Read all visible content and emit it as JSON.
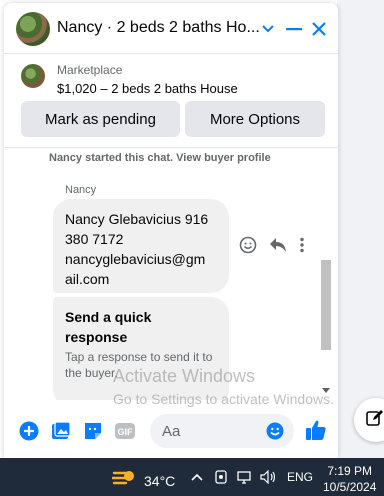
{
  "header": {
    "title": "Nancy · 2 beds 2 baths Ho..."
  },
  "listing": {
    "category": "Marketplace",
    "title": "$1,020 – 2 beds 2 baths House",
    "mark_pending_label": "Mark as pending",
    "more_options_label": "More Options"
  },
  "messages": {
    "system_text": "Nancy started this chat. View buyer profile",
    "sender": "Nancy",
    "bubble_lines": [
      "Nancy Glebavicius 916",
      "380 7172",
      "nancyglebavicius@gm",
      "ail.com"
    ],
    "quick_response_title": "Send a quick response",
    "quick_response_sub": "Tap a response to send it to the buyer."
  },
  "watermark": {
    "line1": "Activate Windows",
    "line2": "Go to Settings to activate Windows."
  },
  "composer": {
    "placeholder": "Aa",
    "gif_label": "GIF"
  },
  "taskbar": {
    "temperature": "34°C",
    "language": "ENG",
    "time": "7:19 PM",
    "date": "10/5/2024"
  },
  "colors": {
    "accent": "#0a7cff",
    "taskbar": "#1f2a3b"
  }
}
